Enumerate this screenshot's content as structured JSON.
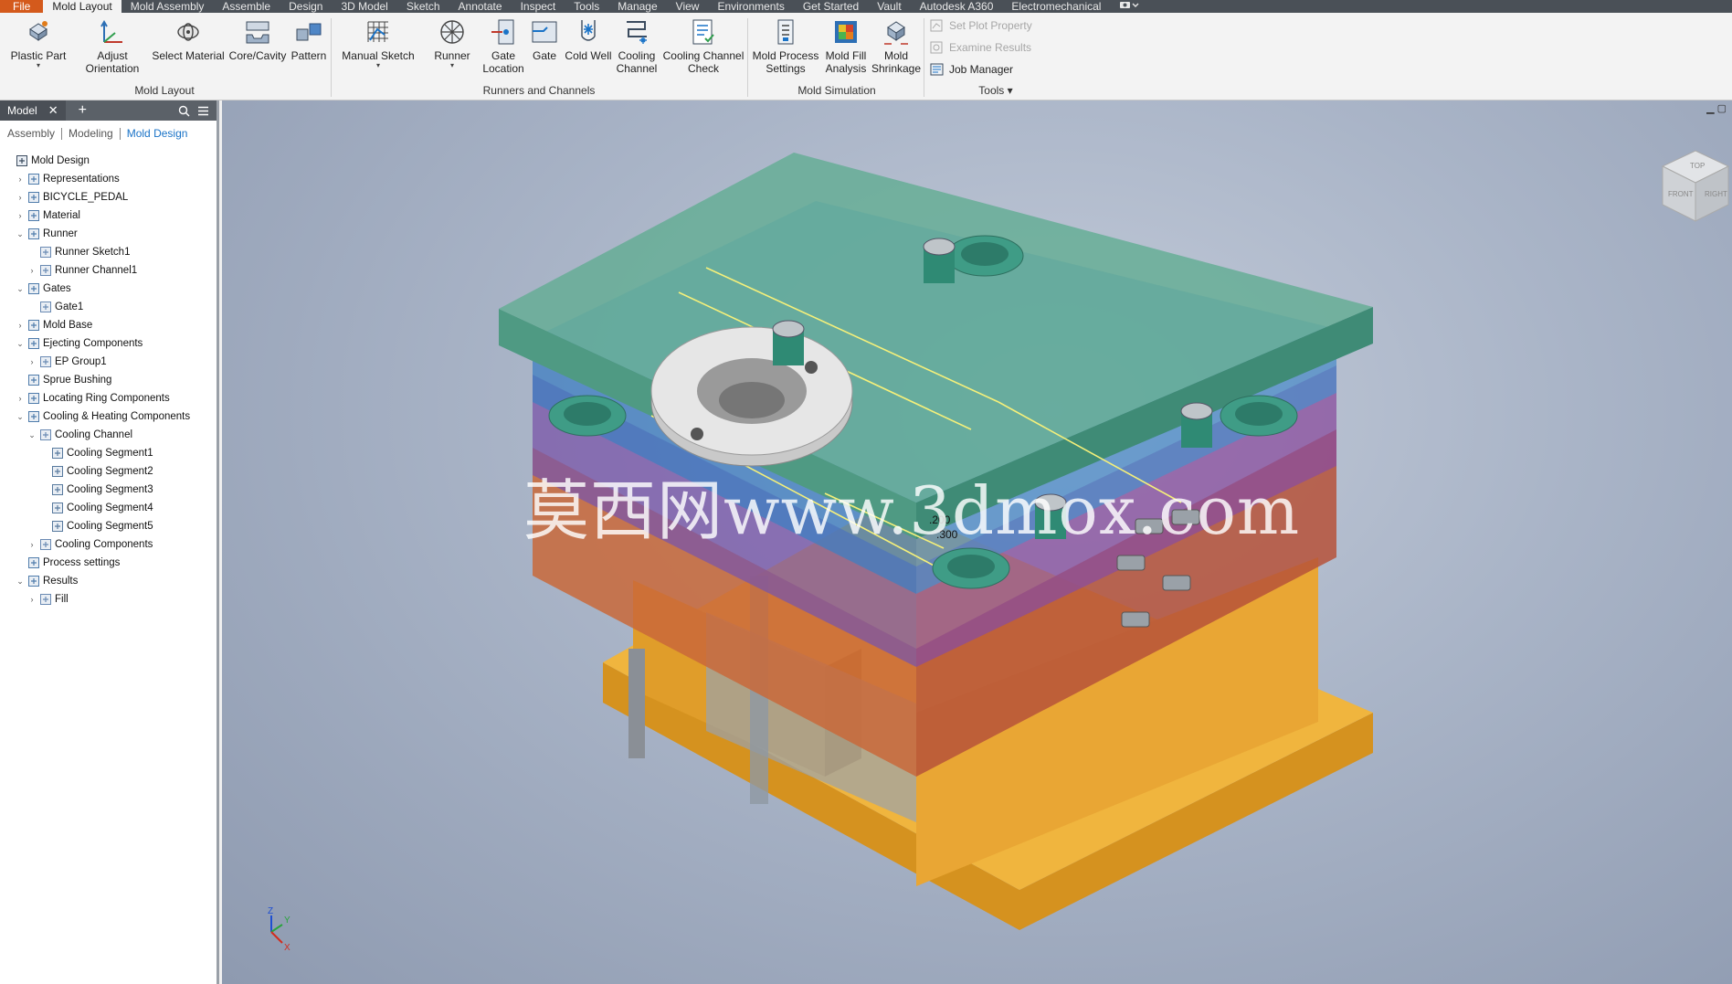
{
  "menu": {
    "file": "File",
    "active": "Mold Layout",
    "tabs": [
      "Mold Assembly",
      "Assemble",
      "Design",
      "3D Model",
      "Sketch",
      "Annotate",
      "Inspect",
      "Tools",
      "Manage",
      "View",
      "Environments",
      "Get Started",
      "Vault",
      "Autodesk A360",
      "Electromechanical"
    ]
  },
  "ribbon": {
    "buttons": [
      {
        "label": "Plastic Part",
        "icon": "plastic-part-icon"
      },
      {
        "label": "Adjust",
        "label2": "Orientation",
        "icon": "adjust-orientation-icon"
      },
      {
        "label": "Select Material",
        "icon": "select-material-icon"
      },
      {
        "label": "Core/Cavity",
        "icon": "core-cavity-icon"
      },
      {
        "label": "Pattern",
        "icon": "pattern-icon"
      },
      {
        "label": "Manual Sketch",
        "icon": "manual-sketch-icon"
      },
      {
        "label": "Runner",
        "icon": "runner-icon"
      },
      {
        "label": "Gate",
        "label2": "Location",
        "icon": "gate-location-icon"
      },
      {
        "label": "Gate",
        "icon": "gate-icon"
      },
      {
        "label": "Cold Well",
        "icon": "cold-well-icon"
      },
      {
        "label": "Cooling",
        "label2": "Channel",
        "icon": "cooling-channel-icon"
      },
      {
        "label": "Cooling Channel",
        "label2": "Check",
        "icon": "cooling-channel-check-icon"
      },
      {
        "label": "Mold Process",
        "label2": "Settings",
        "icon": "mold-process-settings-icon"
      },
      {
        "label": "Mold Fill",
        "label2": "Analysis",
        "icon": "mold-fill-analysis-icon"
      },
      {
        "label": "Mold",
        "label2": "Shrinkage",
        "icon": "mold-shrinkage-icon"
      }
    ],
    "groups": [
      "Mold Layout",
      "Runners and Channels",
      "Mold Simulation",
      "Tools"
    ],
    "tools": [
      "Set Plot Property",
      "Examine Results",
      "Job Manager"
    ]
  },
  "browser": {
    "title": "Model",
    "subtabs": [
      "Assembly",
      "Modeling",
      "Mold Design"
    ],
    "tree": [
      {
        "label": "Mold Design",
        "level": 0,
        "toggle": ""
      },
      {
        "label": "Representations",
        "level": 1,
        "toggle": ">"
      },
      {
        "label": "BICYCLE_PEDAL",
        "level": 1,
        "toggle": ">"
      },
      {
        "label": "Material",
        "level": 1,
        "toggle": ">"
      },
      {
        "label": "Runner",
        "level": 1,
        "toggle": "v"
      },
      {
        "label": "Runner Sketch1",
        "level": 2,
        "toggle": ""
      },
      {
        "label": "Runner Channel1",
        "level": 2,
        "toggle": ">"
      },
      {
        "label": "Gates",
        "level": 1,
        "toggle": "v"
      },
      {
        "label": "Gate1",
        "level": 2,
        "toggle": ""
      },
      {
        "label": "Mold Base",
        "level": 1,
        "toggle": ">"
      },
      {
        "label": "Ejecting Components",
        "level": 1,
        "toggle": "v"
      },
      {
        "label": "EP Group1",
        "level": 2,
        "toggle": ">"
      },
      {
        "label": "Sprue Bushing",
        "level": 1,
        "toggle": ""
      },
      {
        "label": "Locating Ring Components",
        "level": 1,
        "toggle": ">"
      },
      {
        "label": "Cooling & Heating Components",
        "level": 1,
        "toggle": "v"
      },
      {
        "label": "Cooling Channel",
        "level": 2,
        "toggle": "v"
      },
      {
        "label": "Cooling Segment1",
        "level": 3,
        "toggle": ""
      },
      {
        "label": "Cooling Segment2",
        "level": 3,
        "toggle": ""
      },
      {
        "label": "Cooling Segment3",
        "level": 3,
        "toggle": ""
      },
      {
        "label": "Cooling Segment4",
        "level": 3,
        "toggle": ""
      },
      {
        "label": "Cooling Segment5",
        "level": 3,
        "toggle": ""
      },
      {
        "label": "Cooling Components",
        "level": 2,
        "toggle": ">"
      },
      {
        "label": "Process settings",
        "level": 1,
        "toggle": ""
      },
      {
        "label": "Results",
        "level": 1,
        "toggle": "v"
      },
      {
        "label": "Fill",
        "level": 2,
        "toggle": ">"
      }
    ]
  },
  "viewport": {
    "watermark": "莫西网www.3dmox.com",
    "dims": [
      ".200",
      ".300"
    ],
    "viewcube": [
      "TOP",
      "FRONT",
      "RIGHT"
    ],
    "axis": [
      "Z",
      "Y",
      "X"
    ]
  },
  "colors": {
    "file_tab": "#d45a1c",
    "accent": "#1a73c7",
    "top_plate": "#5faa8c",
    "base": "#e5a93a"
  }
}
